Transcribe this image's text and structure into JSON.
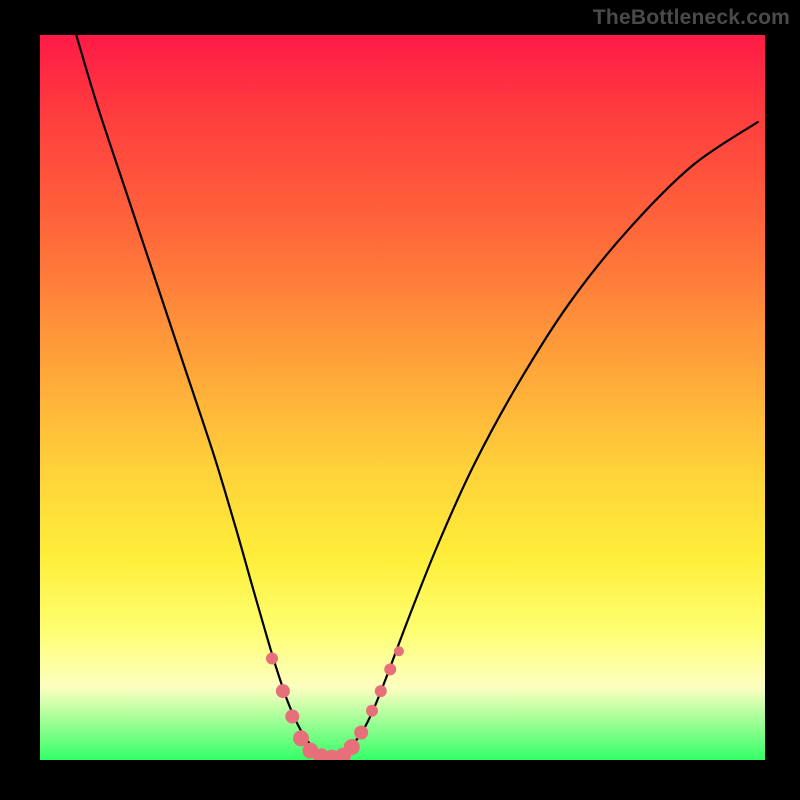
{
  "watermark": {
    "text": "TheBottleneck.com"
  },
  "colors": {
    "gradient_top": "#ff1a47",
    "gradient_mid_orange": "#ff8a3a",
    "gradient_yellow": "#ffee3a",
    "gradient_pale": "#fdffc0",
    "gradient_bottom": "#33ff66",
    "dot": "#e76f7a",
    "line": "#000000",
    "frame": "#000000"
  },
  "chart_data": {
    "type": "line",
    "title": "",
    "xlabel": "",
    "ylabel": "",
    "xlim": [
      0,
      100
    ],
    "ylim": [
      0,
      100
    ],
    "note": "x and y in 0-100 plot-percentage units; y increases upward. Curve shows an asymmetric V with minimum plateau near x≈38-43, y≈0.",
    "series": [
      {
        "name": "bottleneck-curve",
        "x": [
          5,
          8,
          12,
          16,
          20,
          24,
          27,
          29,
          31,
          32.5,
          34,
          35.5,
          37,
          38.5,
          40,
          41.5,
          43,
          44.5,
          46,
          48,
          51,
          55,
          60,
          66,
          73,
          81,
          90,
          99
        ],
        "values": [
          100,
          90,
          78,
          66,
          54,
          42,
          32,
          25,
          18,
          13,
          8.5,
          5,
          2.5,
          1,
          0.4,
          0.8,
          2,
          4,
          7,
          12,
          20,
          30,
          41,
          52,
          63,
          73,
          82,
          88
        ]
      }
    ],
    "dots": {
      "name": "highlighted-points",
      "points": [
        {
          "x": 32.0,
          "y": 14.0,
          "r": 6
        },
        {
          "x": 33.5,
          "y": 9.5,
          "r": 7
        },
        {
          "x": 34.8,
          "y": 6.0,
          "r": 7
        },
        {
          "x": 36.0,
          "y": 3.0,
          "r": 8
        },
        {
          "x": 37.3,
          "y": 1.3,
          "r": 8
        },
        {
          "x": 38.8,
          "y": 0.5,
          "r": 8
        },
        {
          "x": 40.3,
          "y": 0.3,
          "r": 8
        },
        {
          "x": 41.8,
          "y": 0.6,
          "r": 8
        },
        {
          "x": 43.0,
          "y": 1.8,
          "r": 8
        },
        {
          "x": 44.3,
          "y": 3.8,
          "r": 7
        },
        {
          "x": 45.8,
          "y": 6.8,
          "r": 6
        },
        {
          "x": 47.0,
          "y": 9.5,
          "r": 6
        },
        {
          "x": 48.3,
          "y": 12.5,
          "r": 6
        },
        {
          "x": 49.5,
          "y": 15.0,
          "r": 5
        }
      ]
    }
  }
}
